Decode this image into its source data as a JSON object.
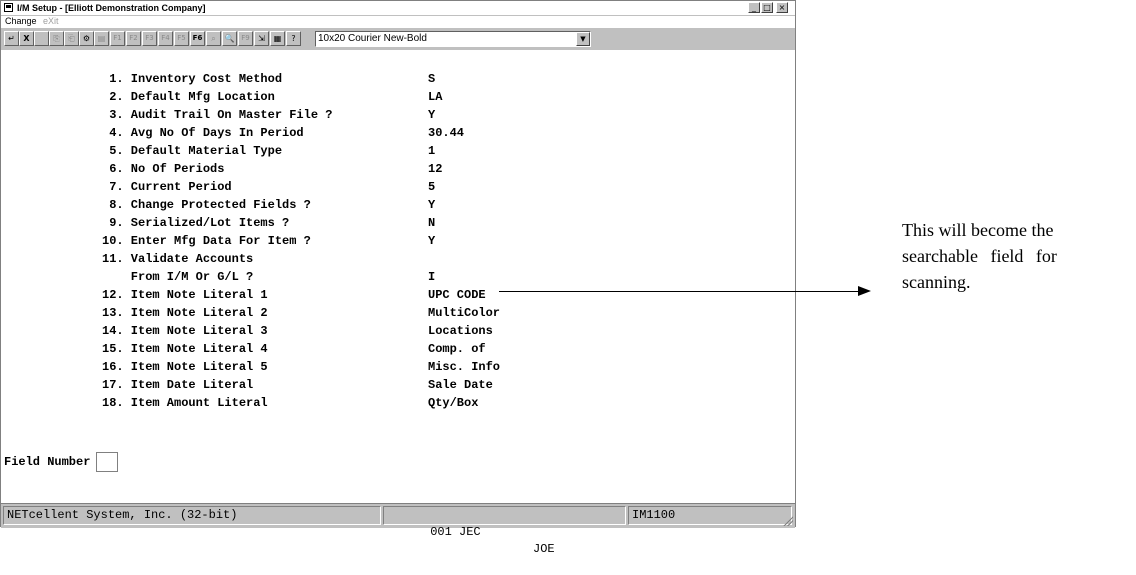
{
  "window": {
    "title": "I/M Setup - [Elliott Demonstration Company]",
    "controls": [
      "_",
      "□",
      "×"
    ]
  },
  "menu": {
    "items": [
      {
        "label": "Change",
        "enabled": true
      },
      {
        "label": "eXit",
        "enabled": false
      }
    ]
  },
  "toolbar": {
    "buttons": [
      {
        "name": "enter-button",
        "glyph": "↵",
        "enabled": true
      },
      {
        "name": "exit-button",
        "glyph": "X",
        "enabled": true
      },
      {
        "name": "blank-button",
        "glyph": "",
        "enabled": false
      },
      {
        "name": "copy-button",
        "glyph": "⎘",
        "enabled": false
      },
      {
        "name": "paste-button",
        "glyph": "⎗",
        "enabled": false
      },
      {
        "name": "settings-button",
        "glyph": "⚙",
        "enabled": true
      },
      {
        "name": "properties-button",
        "glyph": "▤",
        "enabled": false
      },
      {
        "name": "f1-button",
        "glyph": "F1",
        "enabled": false
      },
      {
        "name": "f2-button",
        "glyph": "F2",
        "enabled": false
      },
      {
        "name": "f3-button",
        "glyph": "F3",
        "enabled": false
      },
      {
        "name": "f4-button",
        "glyph": "F4",
        "enabled": false
      },
      {
        "name": "f5-button",
        "glyph": "F5",
        "enabled": false
      },
      {
        "name": "f6-button",
        "glyph": "F6",
        "enabled": true
      },
      {
        "name": "find-button",
        "glyph": "⌕",
        "enabled": false
      },
      {
        "name": "zoom-button",
        "glyph": "🔍",
        "enabled": false
      },
      {
        "name": "f9-button",
        "glyph": "F9",
        "enabled": false
      },
      {
        "name": "export-button",
        "glyph": "⇲",
        "enabled": true
      },
      {
        "name": "notes-button",
        "glyph": "▦",
        "enabled": true
      },
      {
        "name": "help-button",
        "glyph": "?",
        "enabled": true
      }
    ],
    "font_select": {
      "value": "10x20 Courier New-Bold",
      "arrow": "▼"
    }
  },
  "fields": [
    {
      "label": " 1. Inventory Cost Method",
      "value": "S"
    },
    {
      "label": " 2. Default Mfg Location",
      "value": "LA"
    },
    {
      "label": " 3. Audit Trail On Master File ?",
      "value": "Y"
    },
    {
      "label": " 4. Avg No Of Days In Period",
      "value": "30.44"
    },
    {
      "label": " 5. Default Material Type",
      "value": "1"
    },
    {
      "label": " 6. No Of Periods",
      "value": "12"
    },
    {
      "label": " 7. Current Period",
      "value": "5"
    },
    {
      "label": " 8. Change Protected Fields ?",
      "value": "Y"
    },
    {
      "label": " 9. Serialized/Lot Items ?",
      "value": "N"
    },
    {
      "label": "10. Enter Mfg Data For Item ?",
      "value": "Y"
    },
    {
      "label": "11. Validate Accounts",
      "value": ""
    },
    {
      "label": "    From I/M Or G/L ?",
      "value": "I"
    },
    {
      "label": "12. Item Note Literal 1",
      "value": "UPC CODE"
    },
    {
      "label": "13. Item Note Literal 2",
      "value": "MultiColor"
    },
    {
      "label": "14. Item Note Literal 3",
      "value": "Locations"
    },
    {
      "label": "15. Item Note Literal 4",
      "value": "Comp. of"
    },
    {
      "label": "16. Item Note Literal 5",
      "value": "Misc. Info"
    },
    {
      "label": "17. Item Date Literal",
      "value": "Sale Date"
    },
    {
      "label": "18. Item Amount Literal",
      "value": "Qty/Box"
    }
  ],
  "prompt": {
    "label": "Field Number ?",
    "value": ""
  },
  "status": {
    "company": "NETcellent System, Inc. (32-bit)",
    "code": "001 JEC",
    "user": "JOE",
    "program": "IM1100"
  },
  "annotation": {
    "lines": [
      "This will become the",
      "searchable field for",
      "scanning."
    ]
  }
}
